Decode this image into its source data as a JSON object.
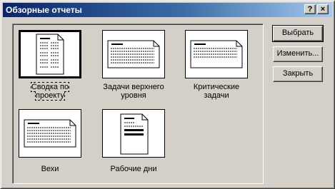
{
  "window": {
    "title": "Обзорные отчеты",
    "help_label": "?",
    "close_label": "×"
  },
  "reports": [
    {
      "label": "Сводка по\nпроекту",
      "selected": true,
      "icon": "portrait-report-icon"
    },
    {
      "label": "Задачи верхнего\nуровня",
      "selected": false,
      "icon": "landscape-report-icon"
    },
    {
      "label": "Критические\nзадачи",
      "selected": false,
      "icon": "landscape-report-icon"
    },
    {
      "label": "Вехи",
      "selected": false,
      "icon": "landscape-report-icon"
    },
    {
      "label": "Рабочие дни",
      "selected": false,
      "icon": "portrait-report-icon"
    }
  ],
  "buttons": {
    "select": "Выбрать",
    "edit": "Изменить...",
    "close": "Закрыть"
  }
}
